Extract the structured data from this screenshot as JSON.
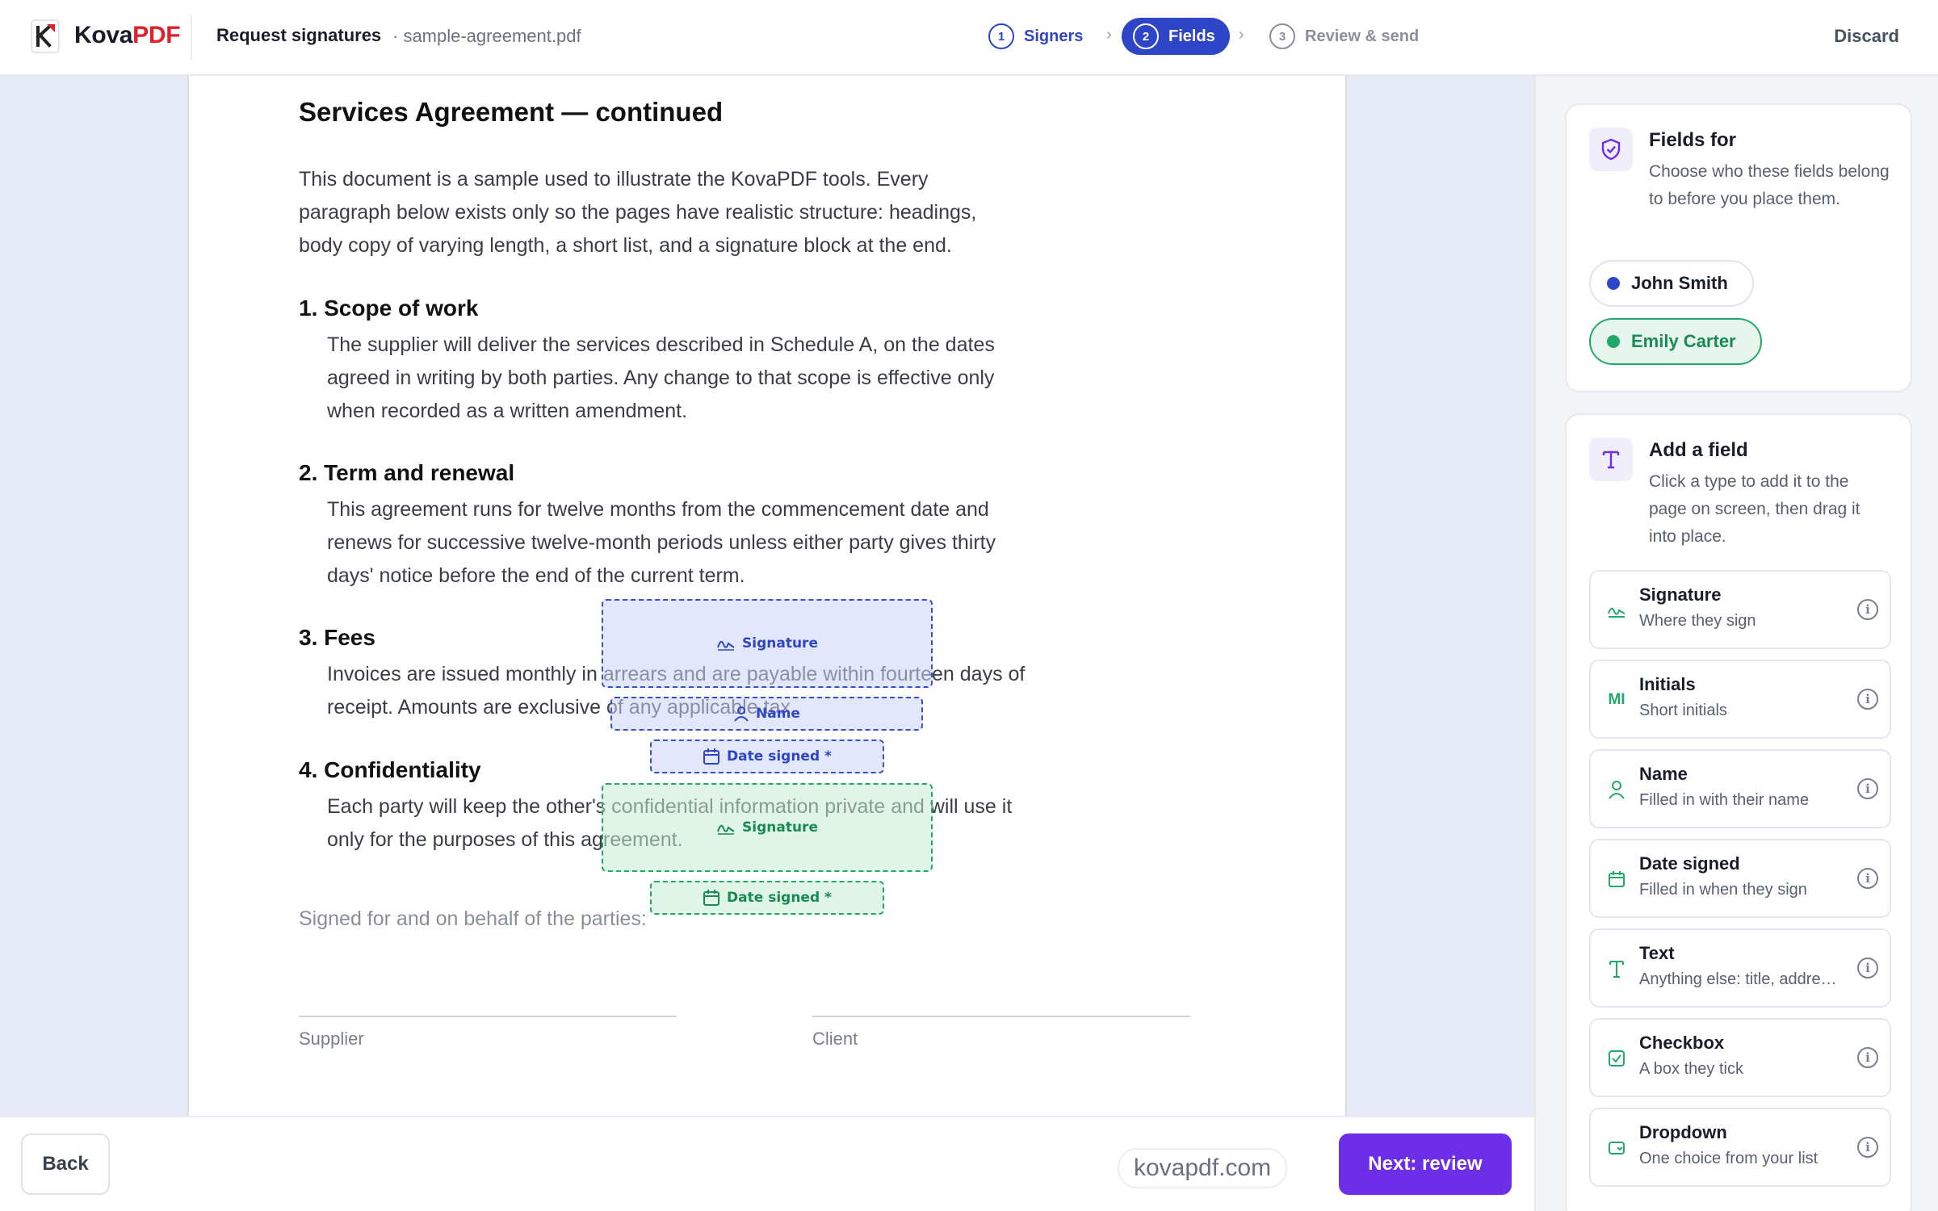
{
  "header": {
    "brand_main": "Kova",
    "brand_accent": "PDF",
    "page_title": "Request signatures",
    "file_name": "· sample-agreement.pdf",
    "steps": [
      {
        "num": "1",
        "label": "Signers",
        "state": "done"
      },
      {
        "num": "2",
        "label": "Fields",
        "state": "active"
      },
      {
        "num": "3",
        "label": "Review & send",
        "state": "upcoming"
      }
    ],
    "discard_label": "Discard"
  },
  "document": {
    "title": "Services Agreement — continued",
    "intro": "This document is a sample used to illustrate the KovaPDF tools. Every paragraph below exists only so the pages have realistic structure: headings, body copy of varying length, a short list, and a signature block at the end.",
    "sections": [
      {
        "heading": "1.  Scope of work",
        "body": "The supplier will deliver the services described in Schedule A, on the dates agreed in writing by both parties. Any change to that scope is effective only when recorded as a written amendment."
      },
      {
        "heading": "2.  Term and renewal",
        "body": "This agreement runs for twelve months from the commencement date and renews for successive twelve-month periods unless either party gives thirty days' notice before the end of the current term."
      },
      {
        "heading": "3.  Fees",
        "body": "Invoices are issued monthly in arrears and are payable within fourteen days of receipt. Amounts are exclusive of any applicable tax."
      },
      {
        "heading": "4.  Confidentiality",
        "body": "Each party will keep the other's confidential information private and will use it only for the purposes of this agreement."
      }
    ],
    "signed_for": "Signed for and on behalf of the parties:",
    "signature_labels": [
      "Supplier",
      "Client"
    ]
  },
  "placed_fields": [
    {
      "label": "Signature",
      "signer": "John Smith",
      "icon": "signature-icon"
    },
    {
      "label": "Name",
      "signer": "John Smith",
      "icon": "person-icon"
    },
    {
      "label": "Date signed *",
      "signer": "John Smith",
      "icon": "calendar-icon"
    },
    {
      "label": "Signature",
      "signer": "Emily Carter",
      "icon": "signature-icon"
    },
    {
      "label": "Date signed *",
      "signer": "Emily Carter",
      "icon": "calendar-icon"
    }
  ],
  "sidebar": {
    "fields_for": {
      "title": "Fields for",
      "description": "Choose who these fields belong to before you place them.",
      "signers": [
        {
          "name": "John Smith",
          "color": "#2f45c8",
          "selected": false
        },
        {
          "name": "Emily Carter",
          "color": "#1fa86a",
          "selected": true
        }
      ]
    },
    "add_field": {
      "title": "Add a field",
      "description": "Click a type to add it to the page on screen, then drag it into place.",
      "types": [
        {
          "label": "Signature",
          "sub": "Where they sign",
          "icon": "signature-icon"
        },
        {
          "label": "Initials",
          "sub": "Short initials",
          "icon": "initials-icon"
        },
        {
          "label": "Name",
          "sub": "Filled in with their name",
          "icon": "person-icon"
        },
        {
          "label": "Date signed",
          "sub": "Filled in when they sign",
          "icon": "calendar-icon"
        },
        {
          "label": "Text",
          "sub": "Anything else: title, address…",
          "icon": "text-icon"
        },
        {
          "label": "Checkbox",
          "sub": "A box they tick",
          "icon": "checkbox-icon"
        },
        {
          "label": "Dropdown",
          "sub": "One choice from your list",
          "icon": "dropdown-icon"
        }
      ]
    }
  },
  "footer": {
    "back_label": "Back",
    "watermark": "kovapdf.com",
    "next_label": "Next: review"
  },
  "colors": {
    "accent_blue": "#2f45c8",
    "accent_green": "#1fa86a",
    "primary_button": "#6d2ee8",
    "brand_red": "#e0202a"
  }
}
